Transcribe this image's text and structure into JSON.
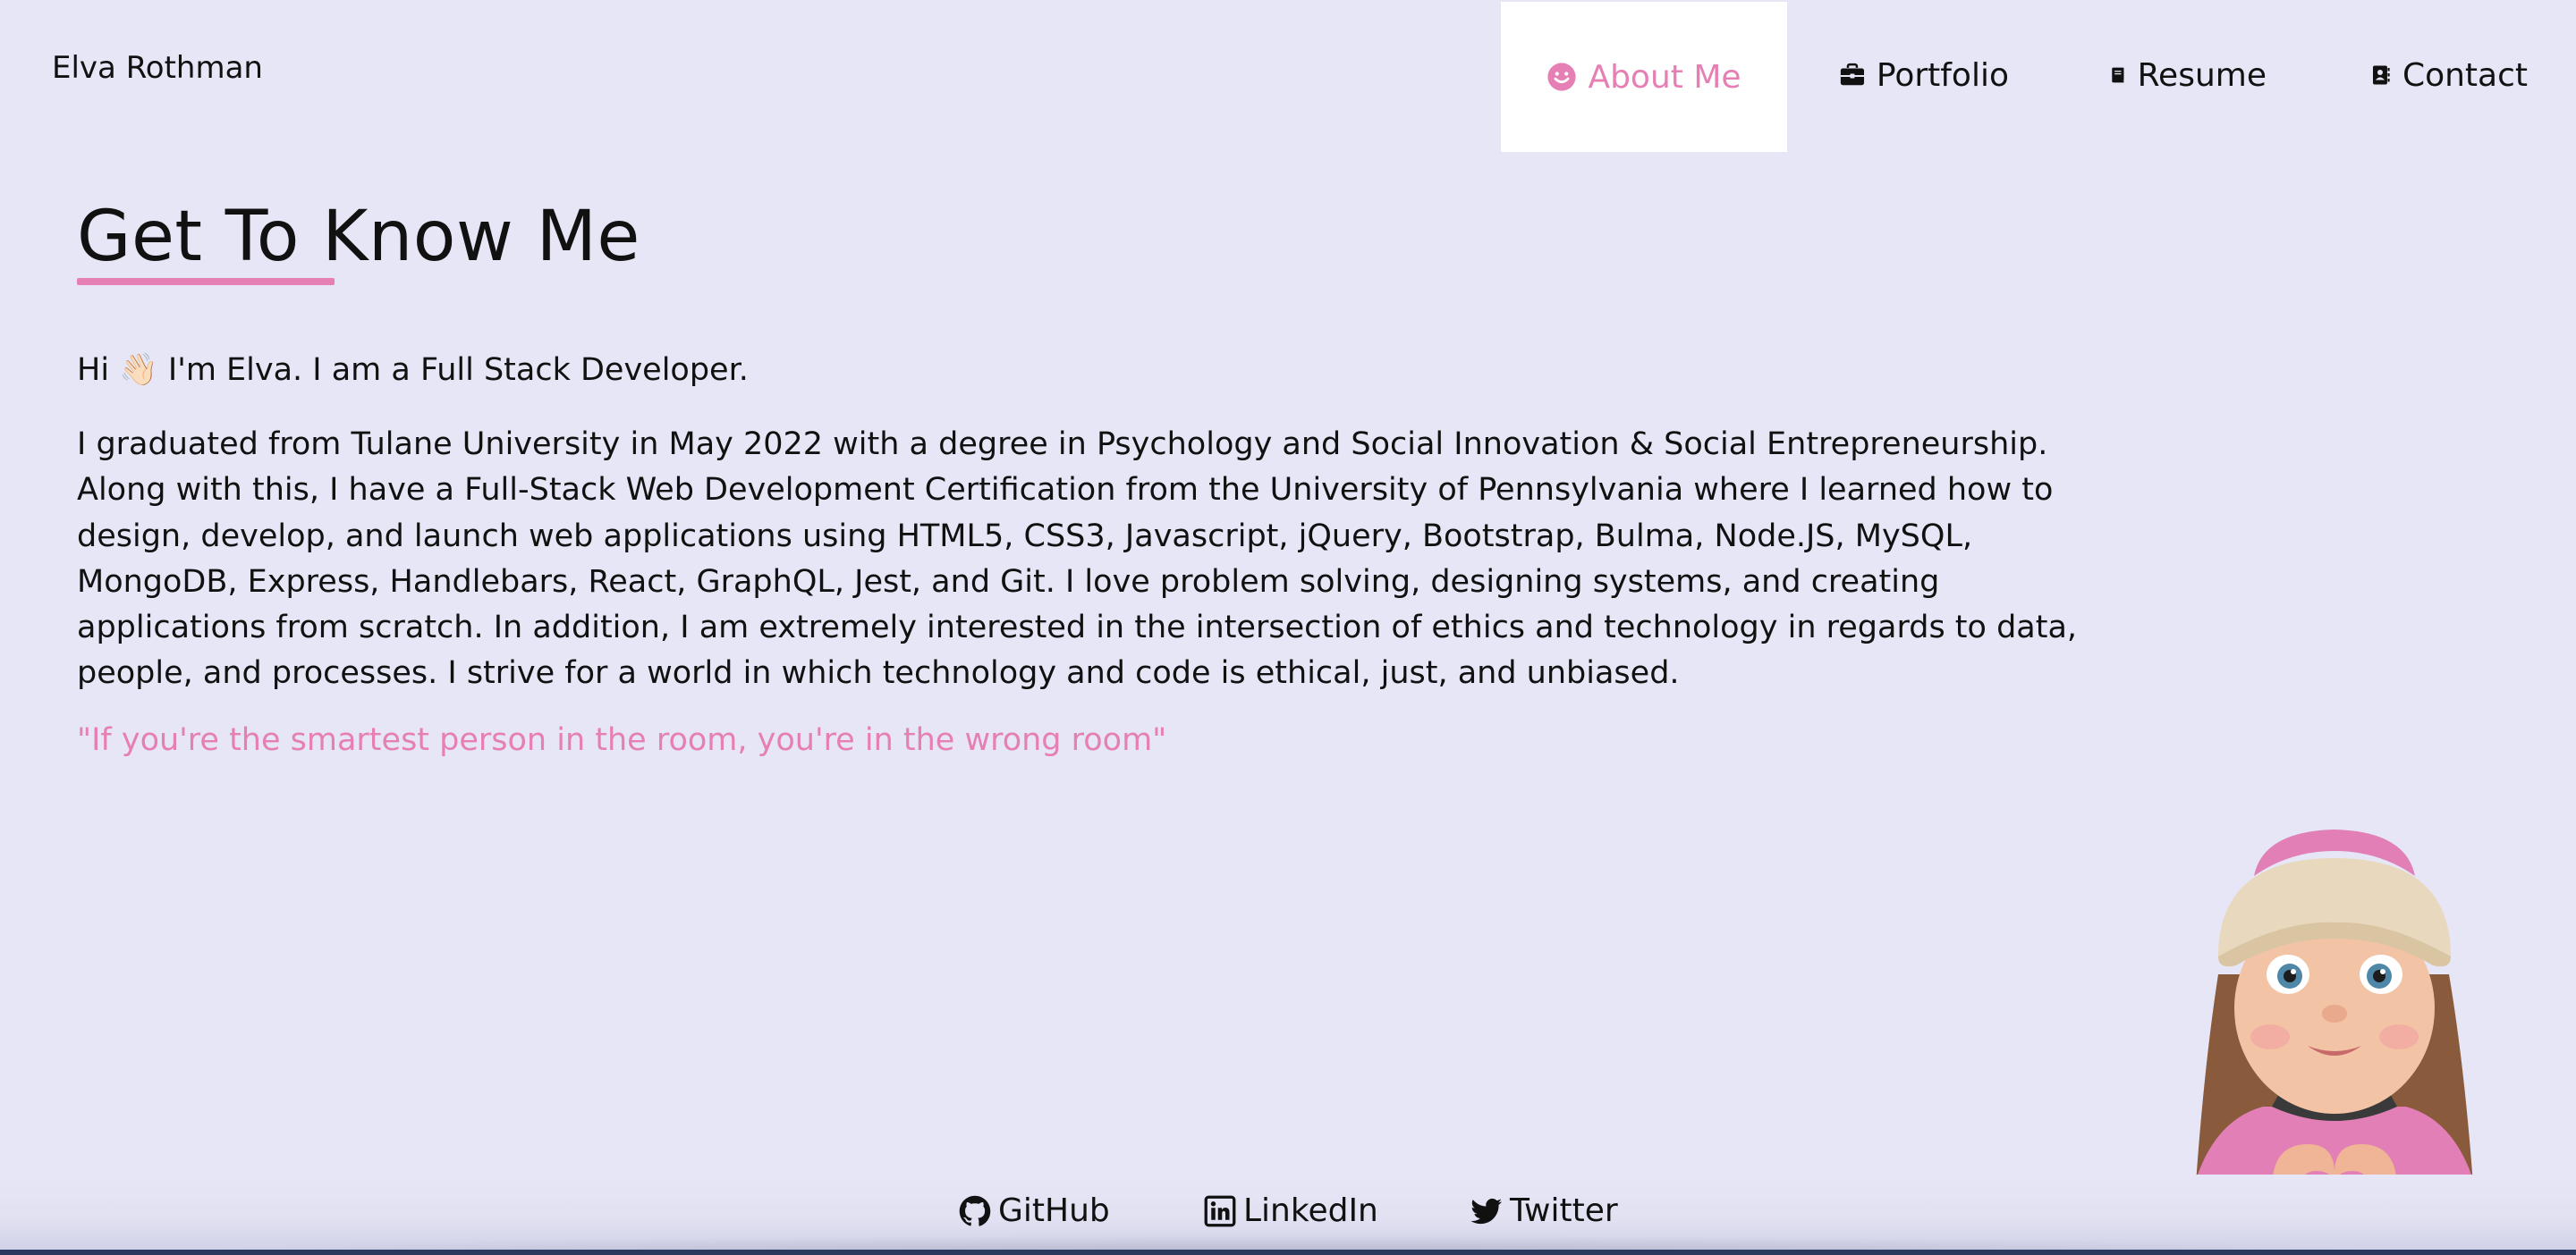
{
  "header": {
    "brand": "Elva Rothman",
    "nav": [
      {
        "label": "About Me",
        "icon": "smile-icon",
        "active": true
      },
      {
        "label": "Portfolio",
        "icon": "briefcase-icon",
        "active": false
      },
      {
        "label": "Resume",
        "icon": "book-icon",
        "active": false
      },
      {
        "label": "Contact",
        "icon": "address-book-icon",
        "active": false
      }
    ]
  },
  "main": {
    "heading": "Get To Know Me",
    "intro": "Hi 👋🏻 I'm Elva. I am a Full Stack Developer.",
    "bio": "I graduated from Tulane University in May 2022 with a degree in Psychology and Social Innovation & Social Entrepreneurship. Along with this, I have a Full-Stack Web Development Certification from the University of Pennsylvania where I learned how to design, develop, and launch web applications using HTML5, CSS3, Javascript, jQuery, Bootstrap, Bulma, Node.JS, MySQL, MongoDB, Express, Handlebars, React, GraphQL, Jest, and Git. I love problem solving, designing systems, and creating applications from scratch. In addition, I am extremely interested in the intersection of ethics and technology in regards to data, people, and processes. I strive for a world in which technology and code is ethical, just, and unbiased.",
    "quote": "\"If you're the smartest person in the room, you're in the wrong room\""
  },
  "footer": {
    "links": [
      {
        "label": "GitHub",
        "icon": "github-icon"
      },
      {
        "label": "LinkedIn",
        "icon": "linkedin-icon"
      },
      {
        "label": "Twitter",
        "icon": "twitter-icon"
      }
    ]
  },
  "colors": {
    "background": "#e6e6f6",
    "accent": "#e67fb4",
    "text": "#111111",
    "active_tab_bg": "#ffffff"
  }
}
